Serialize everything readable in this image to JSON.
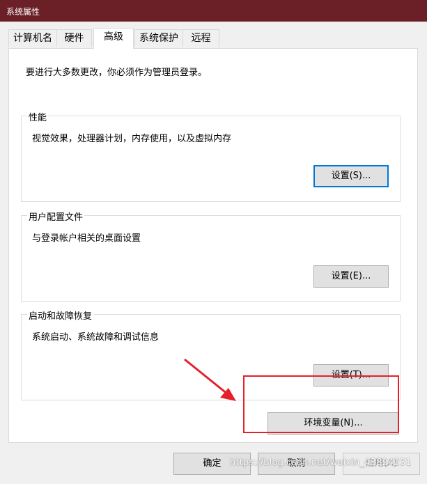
{
  "window": {
    "title": "系统属性"
  },
  "tabs": [
    {
      "label": "计算机名"
    },
    {
      "label": "硬件"
    },
    {
      "label": "高级",
      "active": true
    },
    {
      "label": "系统保护"
    },
    {
      "label": "远程"
    }
  ],
  "advanced": {
    "intro": "要进行大多数更改，你必须作为管理员登录。",
    "performance": {
      "title": "性能",
      "description": "视觉效果，处理器计划，内存使用，以及虚拟内存",
      "button": "设置(S)..."
    },
    "user_profiles": {
      "title": "用户配置文件",
      "description": "与登录帐户相关的桌面设置",
      "button": "设置(E)..."
    },
    "startup_recovery": {
      "title": "启动和故障恢复",
      "description": "系统启动、系统故障和调试信息",
      "button": "设置(T)..."
    },
    "env_vars_button": "环境变量(N)..."
  },
  "footer": {
    "ok": "确定",
    "cancel": "取消",
    "apply": "应用(A)"
  },
  "watermark": "https://blog.csdn.net/weixin_43824231",
  "colors": {
    "titlebar": "#6b2027",
    "annotation": "#e4202a",
    "focus": "#0078d7"
  }
}
